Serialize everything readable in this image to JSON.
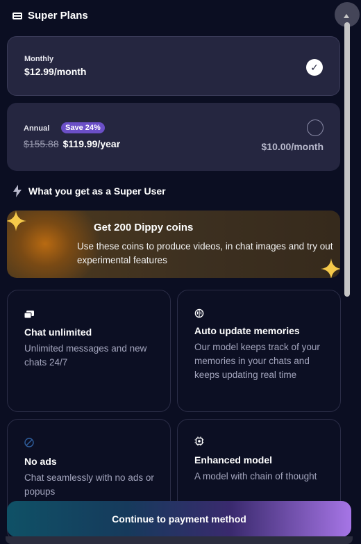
{
  "header": {
    "title": "Super Plans",
    "icon": "card-icon"
  },
  "plans": {
    "monthly": {
      "name": "Monthly",
      "price": "$12.99/month",
      "selected": true
    },
    "annual": {
      "name": "Annual",
      "badge": "Save 24%",
      "old_price": "$155.88",
      "price": "$119.99/year",
      "per_month": "$10.00/month",
      "selected": false
    }
  },
  "section": {
    "title": "What you get as a Super User",
    "icon": "lightning-icon"
  },
  "coins": {
    "title": "Get 200 Dippy coins",
    "description": "Use these coins to produce videos, in chat images and try out experimental features"
  },
  "features": [
    {
      "title": "Chat unlimited",
      "desc": "Unlimited messages and new chats 24/7",
      "icon": "chat-bubbles-icon"
    },
    {
      "title": "Auto update memories",
      "desc": "Our model keeps track of your memories in your chats and keeps updating real time",
      "icon": "brain-icon"
    },
    {
      "title": "No ads",
      "desc": "Chat seamlessly with no ads or popups",
      "icon": "no-ads-icon"
    },
    {
      "title": "Enhanced model",
      "desc": "A model with chain of thought",
      "icon": "chip-icon"
    }
  ],
  "cta": {
    "label": "Continue to payment method"
  },
  "colors": {
    "background": "#0b0e22",
    "plan_card": "#252640",
    "badge": "#6b4fc7",
    "cta_start": "#0f5166",
    "cta_end": "#a675e6"
  }
}
